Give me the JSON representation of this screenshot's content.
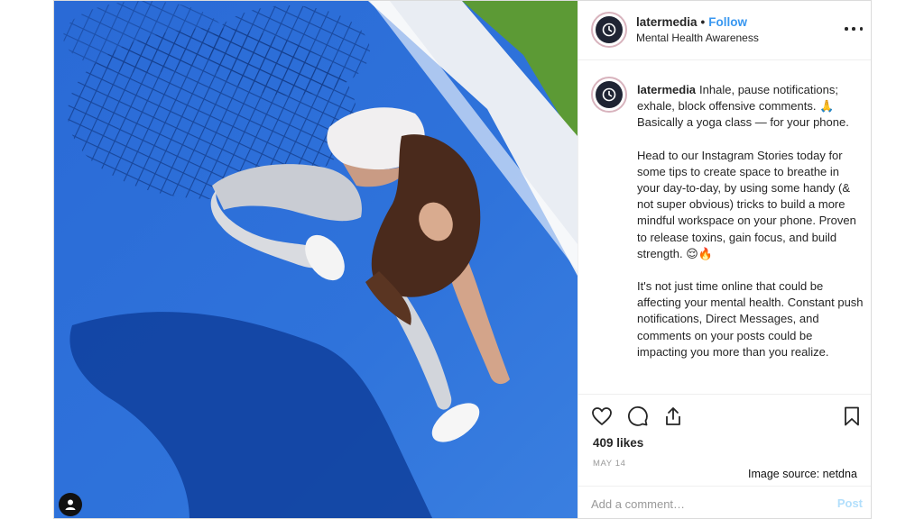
{
  "post": {
    "username": "latermedia",
    "follow_label": "Follow",
    "location": "Mental Health Awareness",
    "more_icon": "more-horizontal-icon",
    "caption_paragraphs": [
      "Inhale, pause notifications; exhale, block offensive comments. 🙏 Basically a yoga class — for your phone.",
      "Head to our Instagram Stories today for some tips to create space to breathe in your day-to-day, by using some handy (& not super obvious) tricks to build a more mindful workspace on your phone. Proven to release toxins, gain focus, and build strength. 😌🔥",
      "It's not just time online that could be affecting your mental health. Constant push notifications, Direct Messages, and comments on your posts could be impacting you more than you realize."
    ],
    "likes": "409 likes",
    "date": "MAY 14",
    "comment_placeholder": "Add a comment…",
    "post_button": "Post"
  },
  "actions": {
    "like_icon": "heart-icon",
    "comment_icon": "comment-icon",
    "share_icon": "share-icon",
    "save_icon": "bookmark-icon"
  },
  "source_note": "Image source: netdna",
  "colors": {
    "court_blue": "#2f6fd6",
    "follow_blue": "#3897f0",
    "post_disabled": "#b2dffc",
    "grass": "#5c9a35"
  }
}
